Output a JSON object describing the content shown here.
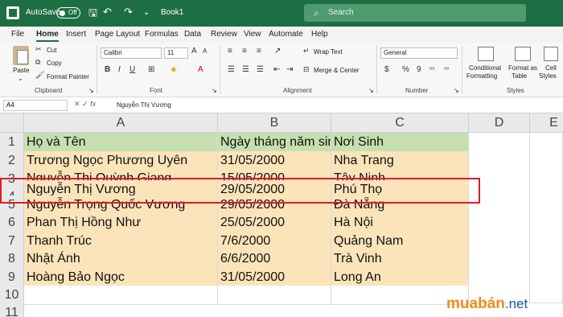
{
  "titlebar": {
    "autosave_label": "AutoSave",
    "autosave_state": "Off",
    "book_title": "Book1",
    "search_placeholder": "Search",
    "undo_icon": "undo-icon",
    "redo_icon": "redo-icon",
    "save_icon": "save-icon"
  },
  "menu": [
    "File",
    "Home",
    "Insert",
    "Page Layout",
    "Formulas",
    "Data",
    "Review",
    "View",
    "Automate",
    "Help"
  ],
  "ribbon": {
    "paste": "Paste",
    "cut": "Cut",
    "copy": "Copy",
    "format_painter": "Format Painter",
    "clipboard": "Clipboard",
    "font_name": "Calibri",
    "font_size": "11",
    "font_group": "Font",
    "wrap_text": "Wrap Text",
    "merge_center": "Merge & Center",
    "alignment": "Alignment",
    "number_format": "General",
    "number": "Number",
    "conditional": "Conditional",
    "formatting": "Formatting",
    "format_as": "Format as",
    "table": "Table",
    "cell": "Cell",
    "styles_btn": "Styles",
    "styles_group": "Styles",
    "percent": "%",
    "comma": "9"
  },
  "formula": {
    "name_box": "A4",
    "fx": "fx",
    "content": "Nguyễn Thị Vương"
  },
  "columns": [
    "A",
    "B",
    "C",
    "D",
    "E"
  ],
  "rows": [
    "1",
    "2",
    "3",
    "4",
    "5",
    "6",
    "7",
    "8",
    "9",
    "10",
    "11"
  ],
  "table": [
    [
      "Họ và Tên",
      "Ngày tháng năm sinh",
      "Nơi Sinh"
    ],
    [
      "Trương Ngọc Phương Uyên",
      "31/05/2000",
      "Nha Trang"
    ],
    [
      "Nguyễn Thị Quỳnh Giang",
      "15/05/2000",
      "Tây Ninh"
    ],
    [
      "Nguyễn Thị Vương",
      "29/05/2000",
      "Phú Thọ"
    ],
    [
      "Nguyễn Trọng Quốc Vương",
      "29/05/2000",
      "Đà Nẵng"
    ],
    [
      "Phan Thị Hồng Như",
      "25/05/2000",
      "Hà Nội"
    ],
    [
      "Thanh Trúc",
      "7/6/2000",
      "Quảng Nam"
    ],
    [
      "Nhật Ánh",
      "6/6/2000",
      "Trà Vinh"
    ],
    [
      "Hoàng Bảo Ngọc",
      "31/05/2000",
      "Long An"
    ]
  ],
  "watermark": {
    "brand": "muabán",
    "suffix": ".net"
  },
  "colors": {
    "excel_green": "#1e6e43",
    "header_fill": "#c6dfb0",
    "data_fill": "#fbe4ba",
    "selection_box": "#e01b24"
  }
}
